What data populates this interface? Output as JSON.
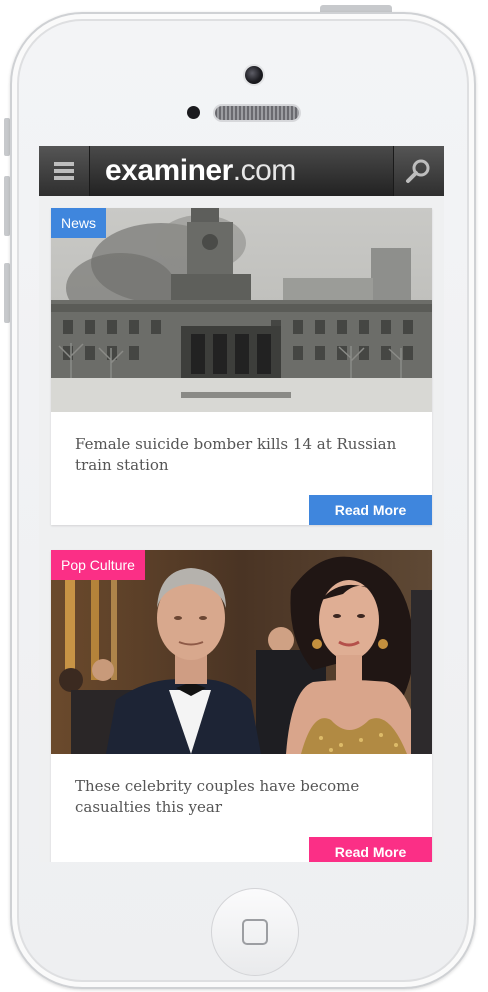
{
  "header": {
    "logo_brand": "examiner",
    "logo_tld": ".com"
  },
  "icons": {
    "menu": "hamburger-menu-icon",
    "search": "search-icon"
  },
  "colors": {
    "news_accent": "#3f86dd",
    "pop_accent": "#fb2f86",
    "topbar": "#2a2a2a"
  },
  "articles": [
    {
      "category": "News",
      "headline": "Female suicide bomber kills 14 at Russian train station",
      "read_more": "Read More"
    },
    {
      "category": "Pop Culture",
      "headline": "These celebrity couples have become casualties this year",
      "read_more": "Read More"
    }
  ]
}
